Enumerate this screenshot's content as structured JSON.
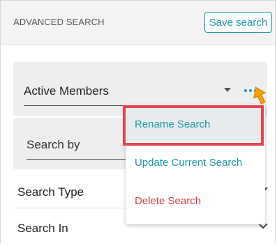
{
  "header": {
    "title": "ADVANCED SEARCH",
    "save_label": "Save search"
  },
  "saved_search": {
    "selected": "Active Members",
    "more_icon": "more-horizontal-icon"
  },
  "search_by": {
    "label": "Search by"
  },
  "sections": [
    {
      "label": "Search Type",
      "icon": "chevron-down-icon"
    },
    {
      "label": "Search In",
      "icon": "chevron-down-icon"
    }
  ],
  "menu": {
    "items": [
      {
        "label": "Rename Search",
        "highlighted": true
      },
      {
        "label": "Update Current Search"
      },
      {
        "label": "Delete Search"
      }
    ]
  },
  "colors": {
    "accent": "#1c9aa6",
    "danger": "#d03a4b",
    "highlight_box": "#e8434f",
    "cursor": "#f5a400"
  }
}
